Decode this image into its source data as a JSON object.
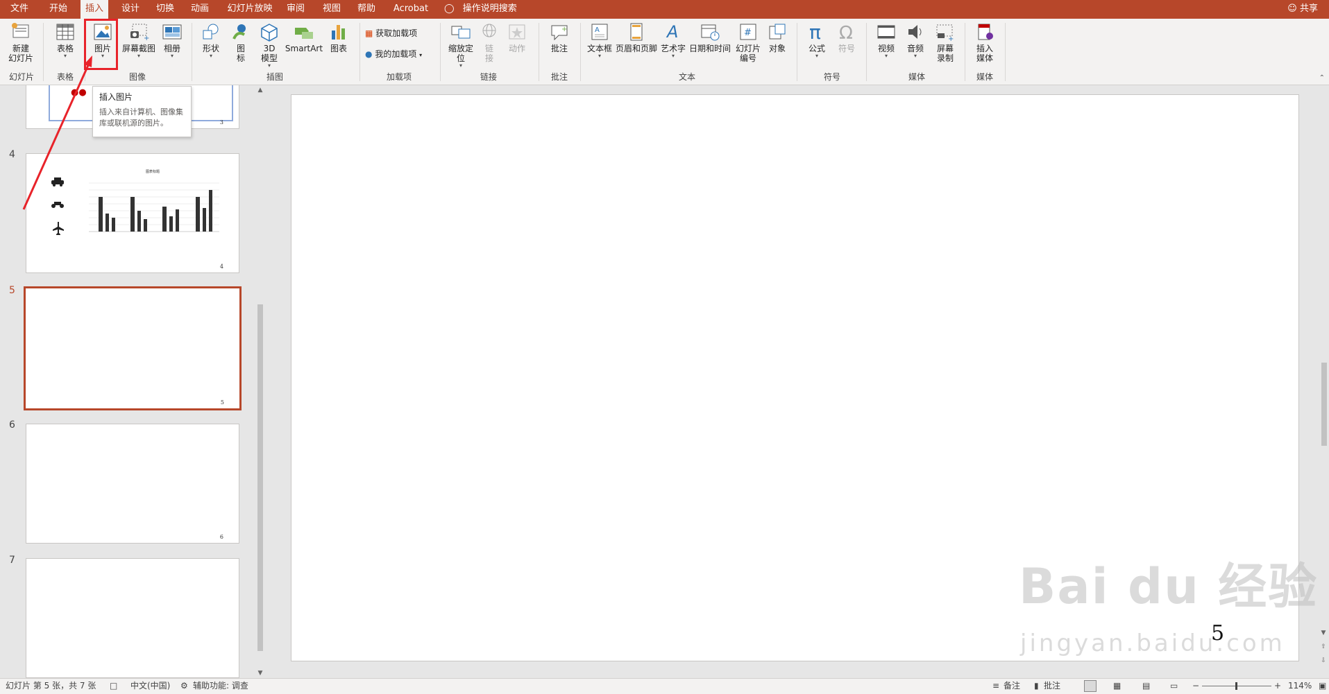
{
  "tabs": [
    {
      "label": "文件"
    },
    {
      "label": "开始"
    },
    {
      "label": "插入"
    },
    {
      "label": "设计"
    },
    {
      "label": "切换"
    },
    {
      "label": "动画"
    },
    {
      "label": "幻灯片放映"
    },
    {
      "label": "审阅"
    },
    {
      "label": "视图"
    },
    {
      "label": "帮助"
    },
    {
      "label": "Acrobat"
    }
  ],
  "active_tab": "插入",
  "tell_me": "操作说明搜索",
  "share": "共享",
  "ribbon": {
    "new_slide": "新建\n幻灯片",
    "table": "表格",
    "picture": "图片",
    "screenshot": "屏幕截图",
    "album": "相册",
    "shapes": "形状",
    "icons": "图\n标",
    "model3d": "3D\n模型",
    "smartart": "SmartArt",
    "chart": "图表",
    "get_addins": "获取加载项",
    "my_addins": "我的加载项",
    "zoom": "缩放定\n位",
    "link": "链\n接",
    "action": "动作",
    "comment": "批注",
    "textbox": "文本框",
    "header_footer": "页眉和页脚",
    "wordart": "艺术字",
    "datetime": "日期和时间",
    "slide_number": "幻灯片\n编号",
    "object": "对象",
    "equation": "公式",
    "symbol": "符号",
    "video": "视频",
    "audio": "音频",
    "screen_recording": "屏幕\n录制",
    "insert_media": "插入\n媒体",
    "groups": {
      "slides": "幻灯片",
      "tables": "表格",
      "images": "图像",
      "illustrations": "插图",
      "addins": "加载项",
      "links": "链接",
      "comments": "批注",
      "text": "文本",
      "symbols": "符号",
      "media": "媒体",
      "media2": "媒体"
    }
  },
  "tooltip": {
    "title": "插入图片",
    "desc": "插入来自计算机、图像集库或联机源的图片。"
  },
  "thumbnails": [
    {
      "num": "",
      "page": "3"
    },
    {
      "num": "4",
      "page": "4",
      "chart_title": "图表标题"
    },
    {
      "num": "5",
      "page": "5"
    },
    {
      "num": "6",
      "page": "6"
    },
    {
      "num": "7",
      "page": ""
    }
  ],
  "slide_page_number": "5",
  "watermark": {
    "main": "Bai du 经验",
    "sub": "jingyan.baidu.com"
  },
  "statusbar": {
    "slide_info": "幻灯片 第 5 张，共 7 张",
    "language": "中文(中国)",
    "accessibility": "辅助功能: 调查",
    "notes": "备注",
    "comments": "批注",
    "zoom": "114%"
  },
  "colors": {
    "accent": "#B7472A",
    "highlight": "#E8232A"
  }
}
